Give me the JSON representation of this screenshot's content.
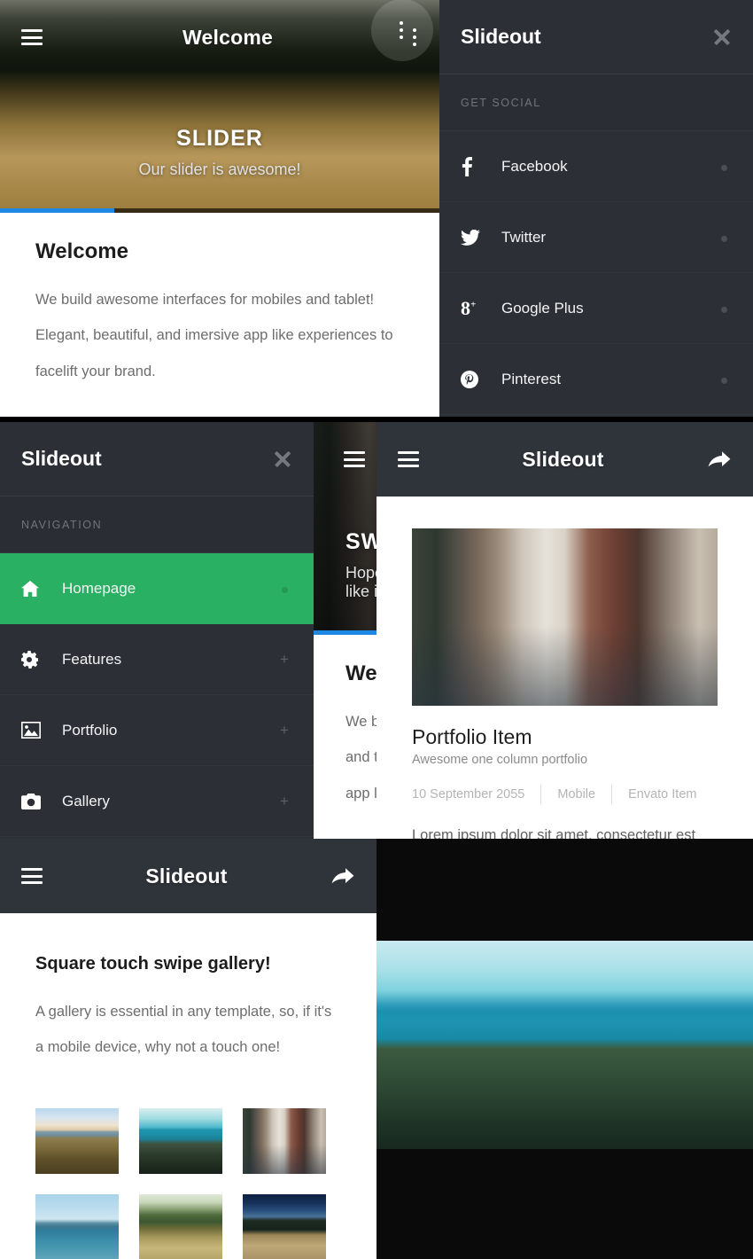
{
  "brand": "Slideout",
  "panel_slider": {
    "appbar": {
      "title": "Welcome",
      "menu_icon": "hamburger-icon",
      "overflow_icon": "kebab-menu-icon",
      "overflow_icon_2": "kebab-menu-icon"
    },
    "hero": {
      "title": "SLIDER",
      "subtitle": "Our slider is awesome!",
      "progress_percent": 26
    },
    "content": {
      "heading": "Welcome",
      "paragraph": "We build awesome interfaces for mobiles and tablet! Elegant, beautiful, and imersive app like experiences to facelift your brand."
    }
  },
  "panel_social": {
    "brand": "Slideout",
    "close_icon": "close-icon",
    "section_label": "GET SOCIAL",
    "items": [
      {
        "label": "Facebook",
        "icon": "facebook-icon",
        "meta": "dot"
      },
      {
        "label": "Twitter",
        "icon": "twitter-icon",
        "meta": "dot"
      },
      {
        "label": "Google Plus",
        "icon": "google-plus-icon",
        "meta": "dot"
      },
      {
        "label": "Pinterest",
        "icon": "pinterest-icon",
        "meta": "dot"
      }
    ]
  },
  "panel_navigation": {
    "brand": "Slideout",
    "close_icon": "close-icon",
    "section_label": "NAVIGATION",
    "active_color": "#2ab062",
    "items": [
      {
        "label": "Homepage",
        "icon": "home-icon",
        "meta": "dot",
        "active": true
      },
      {
        "label": "Features",
        "icon": "gear-icon",
        "meta": "+",
        "active": false
      },
      {
        "label": "Portfolio",
        "icon": "image-icon",
        "meta": "+",
        "active": false
      },
      {
        "label": "Gallery",
        "icon": "camera-icon",
        "meta": "+",
        "active": false
      }
    ]
  },
  "panel_swipe": {
    "appbar": {
      "menu_icon": "hamburger-icon"
    },
    "hero": {
      "title": "SWIPE",
      "subtitle": "Hope you like it!",
      "progress_percent": 100
    },
    "content": {
      "heading": "Welcome",
      "lines": [
        "We build awesome",
        "and tablet! Elegant,",
        "app like experiences"
      ]
    }
  },
  "panel_portfolio": {
    "appbar": {
      "title": "Slideout",
      "menu_icon": "hamburger-icon",
      "share_icon": "share-icon"
    },
    "item": {
      "image": "city-street-photo",
      "title": "Portfolio Item",
      "subtitle": "Awesome one column portfolio",
      "meta": [
        "10 September 2055",
        "Mobile",
        "Envato Item"
      ],
      "body": "Lorem ipsum dolor sit amet, consectetur est"
    }
  },
  "panel_gallery": {
    "appbar": {
      "title": "Slideout",
      "menu_icon": "hamburger-icon",
      "share_icon": "share-icon"
    },
    "heading": "Square touch swipe gallery!",
    "paragraph": "A gallery is essential in any template, so, if it's a mobile device, why not a touch one!",
    "thumbnails": [
      {
        "name": "beach-driftwood-photo"
      },
      {
        "name": "lake-trees-photo"
      },
      {
        "name": "city-street-photo"
      },
      {
        "name": "calm-sea-photo"
      },
      {
        "name": "wheat-field-photo"
      },
      {
        "name": "cypress-night-photo"
      }
    ]
  },
  "panel_lightbox": {
    "photo": "forest-lake-panorama-photo",
    "background": "#0a0a0a"
  }
}
